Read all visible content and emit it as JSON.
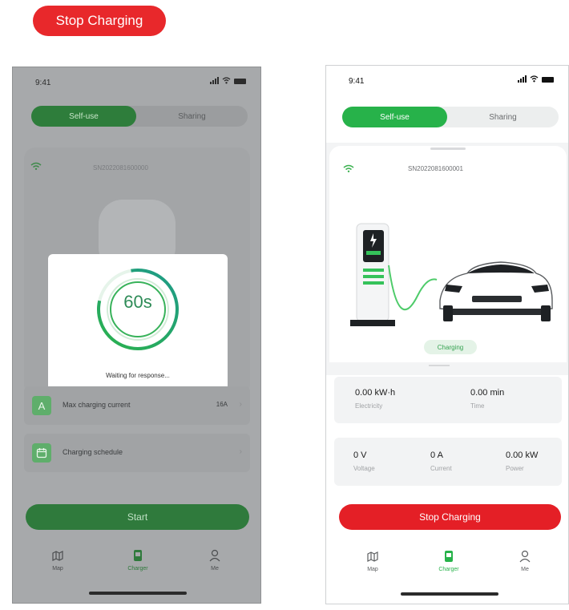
{
  "top_button": {
    "label": "Stop Charging"
  },
  "left_phone": {
    "status_time": "9:41",
    "tabs": {
      "active": "Self-use",
      "inactive": "Sharing"
    },
    "serial": "SN2022081600000",
    "modal": {
      "countdown": "60s",
      "message": "Waiting for response..."
    },
    "rows": [
      {
        "badge": "A",
        "label": "Max charging current",
        "value": "16A"
      },
      {
        "badge": "",
        "label": "Charging schedule",
        "value": ""
      }
    ],
    "start_label": "Start",
    "nav": [
      "Map",
      "Charger",
      "Me"
    ]
  },
  "right_phone": {
    "status_time": "9:41",
    "tabs": {
      "active": "Self-use",
      "inactive": "Sharing"
    },
    "serial": "SN2022081600001",
    "status_badge": "Charging",
    "stats_row1": [
      {
        "value": "0.00 kW·h",
        "label": "Electricity"
      },
      {
        "value": "0.00 min",
        "label": "Time"
      }
    ],
    "stats_row2": [
      {
        "value": "0 V",
        "label": "Voltage"
      },
      {
        "value": "0 A",
        "label": "Current"
      },
      {
        "value": "0.00 kW",
        "label": "Power"
      }
    ],
    "stop_label": "Stop Charging",
    "nav": [
      "Map",
      "Charger",
      "Me"
    ]
  },
  "colors": {
    "brand_green": "#27b24a",
    "stop_red": "#e41f26",
    "dim_overlay": "#a7a9ab"
  },
  "icons": [
    "wifi-icon",
    "signal-icon",
    "battery-icon",
    "map-icon",
    "charger-icon",
    "user-icon",
    "calendar-icon",
    "current-icon"
  ]
}
